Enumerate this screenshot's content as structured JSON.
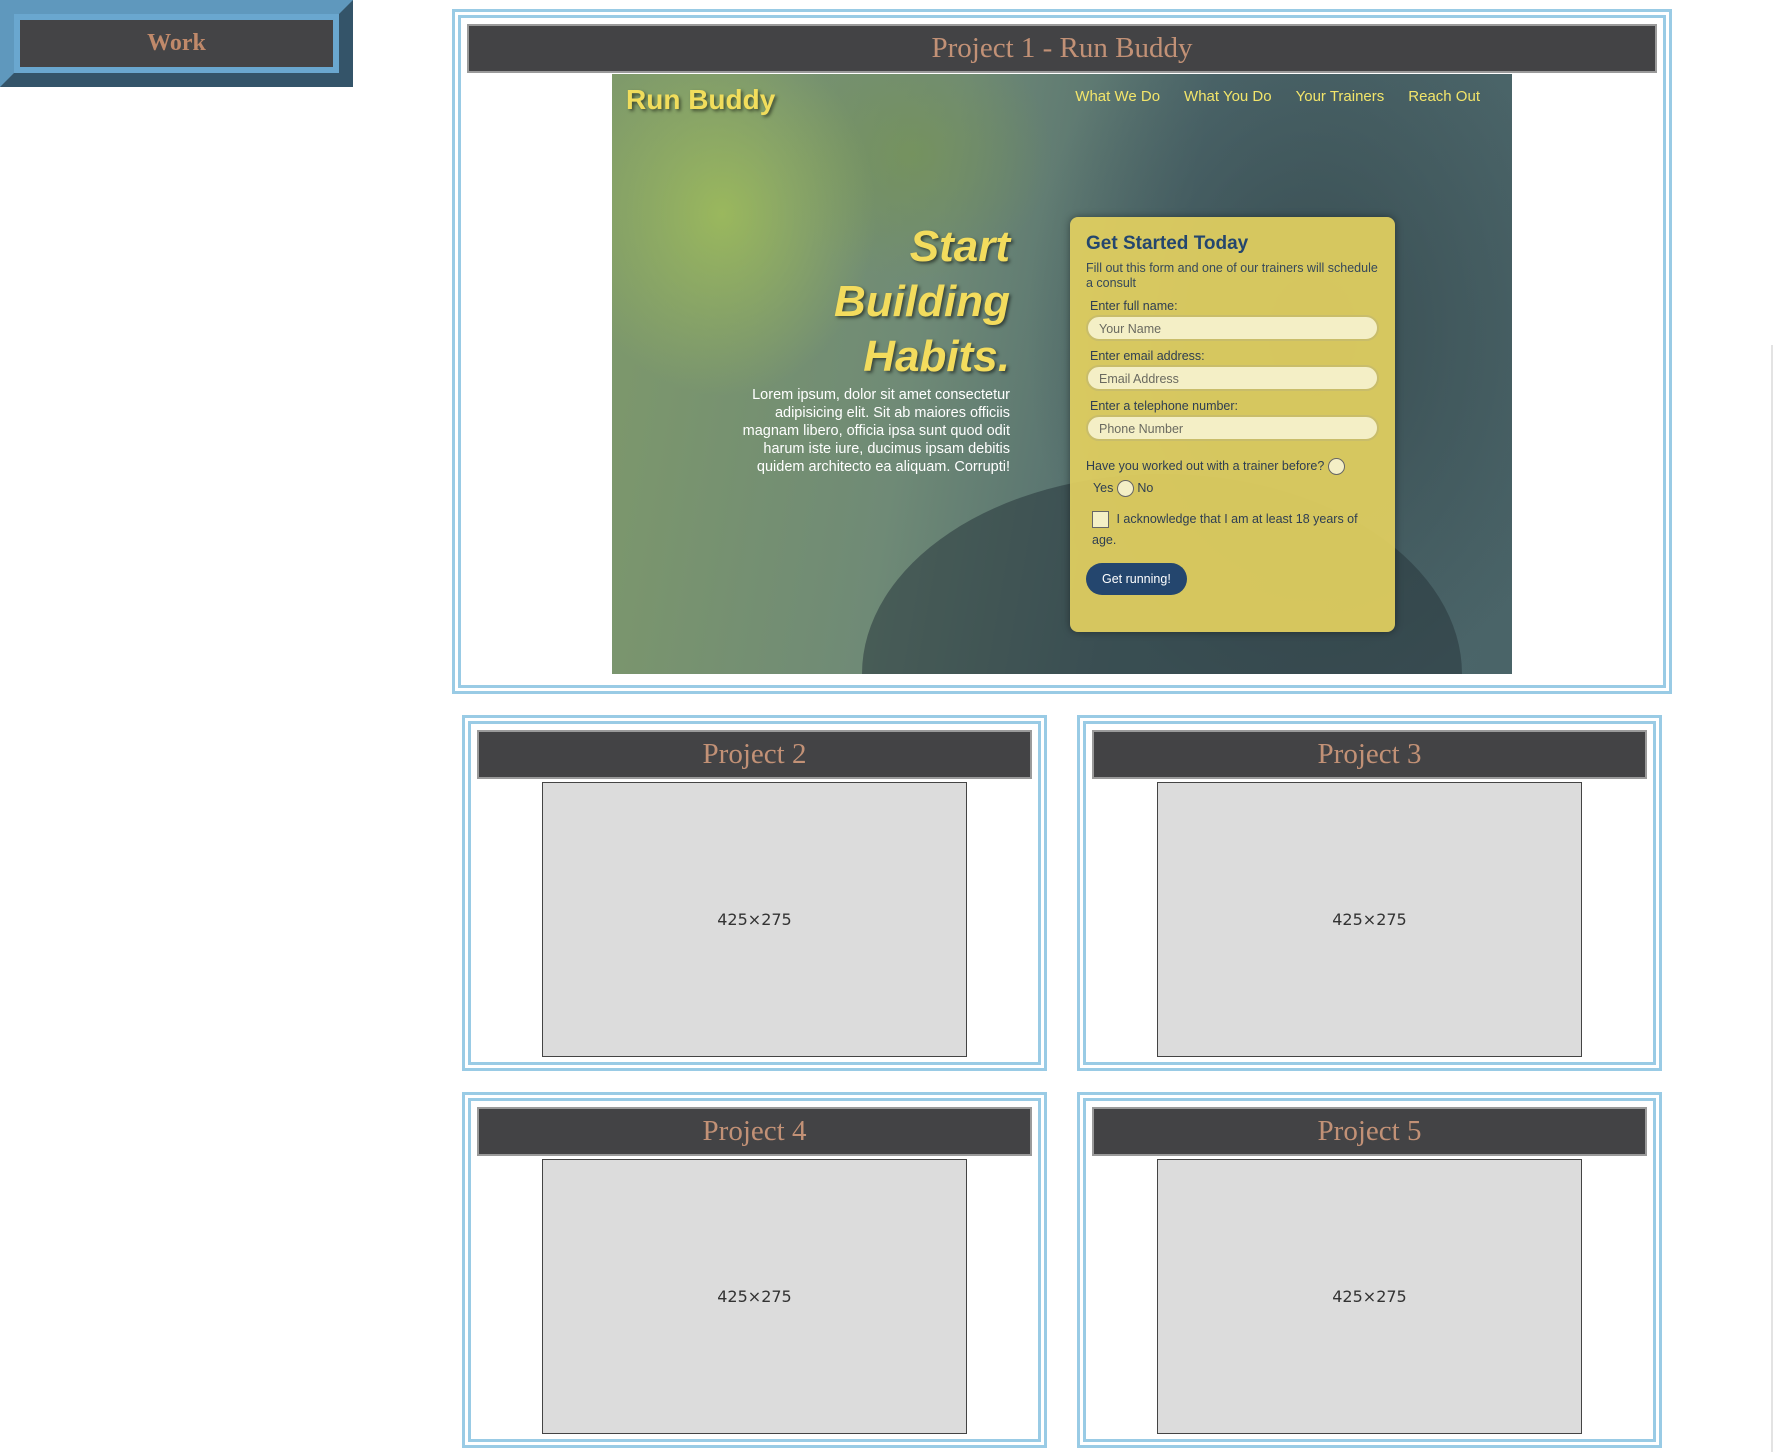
{
  "section": {
    "heading": "Work"
  },
  "featured": {
    "title": "Project 1 - Run Buddy",
    "screenshot": {
      "logo": "Run Buddy",
      "nav": [
        "What We Do",
        "What You Do",
        "Your Trainers",
        "Reach Out"
      ],
      "hero_title_lines": [
        "Start",
        "Building",
        "Habits."
      ],
      "hero_text": "Lorem ipsum, dolor sit amet consectetur adipisicing elit. Sit ab maiores officiis magnam libero, officia ipsa sunt quod odit harum iste iure, ducimus ipsam debitis quidem architecto ea aliquam. Corrupti!",
      "form": {
        "title": "Get Started Today",
        "intro": "Fill out this form and one of our trainers will schedule a consult",
        "name_label": "Enter full name:",
        "name_placeholder": "Your Name",
        "email_label": "Enter email address:",
        "email_placeholder": "Email Address",
        "phone_label": "Enter a telephone number:",
        "phone_placeholder": "Phone Number",
        "trainer_question": "Have you worked out with a trainer before?",
        "yes_label": "Yes",
        "no_label": "No",
        "age_ack": "I acknowledge that I am at least 18 years of age.",
        "submit_label": "Get running!"
      }
    }
  },
  "projects": [
    {
      "title": "Project 2",
      "placeholder": "425×275"
    },
    {
      "title": "Project 3",
      "placeholder": "425×275"
    },
    {
      "title": "Project 4",
      "placeholder": "425×275"
    },
    {
      "title": "Project 5",
      "placeholder": "425×275"
    }
  ],
  "colors": {
    "card_border": "#99cbe5",
    "header_bg": "#434345",
    "header_text": "#c29176",
    "work_frame": "#6aa7cf"
  }
}
